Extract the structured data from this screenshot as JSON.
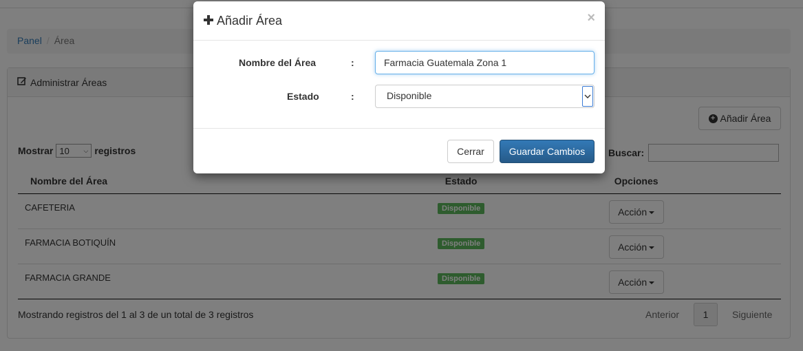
{
  "breadcrumb": {
    "home": "Panel",
    "current": "Área"
  },
  "panel": {
    "title": "Administrar Áreas",
    "add_button": "Añadir Área"
  },
  "table_controls": {
    "show_label": "Mostrar",
    "page_size": "10",
    "records_label": "registros",
    "search_label": "Buscar:"
  },
  "table": {
    "headers": [
      "Nombre del Área",
      "Estado",
      "Opciones"
    ],
    "rows": [
      {
        "name": "CAFETERIA",
        "status": "Disponible",
        "action": "Acción"
      },
      {
        "name": "FARMACIA BOTIQUÍN",
        "status": "Disponible",
        "action": "Acción"
      },
      {
        "name": "FARMACIA GRANDE",
        "status": "Disponible",
        "action": "Acción"
      }
    ]
  },
  "footer": {
    "info": "Mostrando registros del 1 al 3 de un total de 3 registros",
    "prev": "Anterior",
    "page": "1",
    "next": "Siguiente"
  },
  "modal": {
    "title": "Añadir Área",
    "close": "×",
    "name_label": "Nombre del Área",
    "name_value": "Farmacia Guatemala Zona 1",
    "status_label": "Estado",
    "status_value": "Disponible",
    "colon": ":",
    "cancel_button": "Cerrar",
    "save_button": "Guardar Cambios"
  },
  "colors": {
    "primary": "#337ab7",
    "success": "#5cb85c",
    "link": "#337ab7"
  }
}
